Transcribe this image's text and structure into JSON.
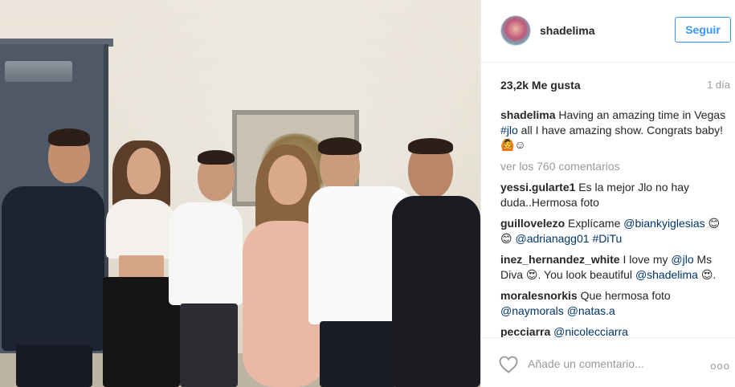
{
  "post": {
    "username": "shadelima",
    "follow_label": "Seguir",
    "likes": "23,2k Me gusta",
    "time": "1 día",
    "caption": {
      "author": "shadelima",
      "text_1": "Having an amazing time in Vegas ",
      "mention_1": "#jlo",
      "text_2": " all I have amazing show. Congrats baby! 🙆☺"
    },
    "view_all": "ver los 760 comentarios",
    "comments": [
      {
        "author": "yessi.gularte1",
        "parts": [
          {
            "t": "text",
            "v": " Es la mejor Jlo no hay duda..Hermosa foto"
          }
        ]
      },
      {
        "author": "guillovelezo",
        "parts": [
          {
            "t": "text",
            "v": " Explícame "
          },
          {
            "t": "mention",
            "v": "@biankyiglesias"
          },
          {
            "t": "text",
            "v": " 😊😊 "
          },
          {
            "t": "mention",
            "v": "@adrianagg01"
          },
          {
            "t": "text",
            "v": " "
          },
          {
            "t": "mention",
            "v": "#DiTu"
          }
        ]
      },
      {
        "author": "inez_hernandez_white",
        "parts": [
          {
            "t": "text",
            "v": " I love my "
          },
          {
            "t": "mention",
            "v": "@jlo"
          },
          {
            "t": "text",
            "v": " Ms Diva 😍. You look beautiful "
          },
          {
            "t": "mention",
            "v": "@shadelima"
          },
          {
            "t": "text",
            "v": " 😍."
          }
        ]
      },
      {
        "author": "moralesnorkis",
        "parts": [
          {
            "t": "text",
            "v": " Que hermosa foto "
          },
          {
            "t": "mention",
            "v": "@naymorals"
          },
          {
            "t": "text",
            "v": " "
          },
          {
            "t": "mention",
            "v": "@natas.a"
          }
        ]
      },
      {
        "author": "pecciarra",
        "parts": [
          {
            "t": "text",
            "v": " "
          },
          {
            "t": "mention",
            "v": "@nicolecciarra"
          }
        ]
      }
    ],
    "add_comment_placeholder": "Añade un comentario...",
    "more_label": "ooo",
    "icons": {
      "like": "heart-icon",
      "more": "more-options-icon"
    }
  },
  "colors": {
    "accent": "#3897f0",
    "mention": "#003569",
    "muted": "#999999",
    "text": "#262626"
  }
}
